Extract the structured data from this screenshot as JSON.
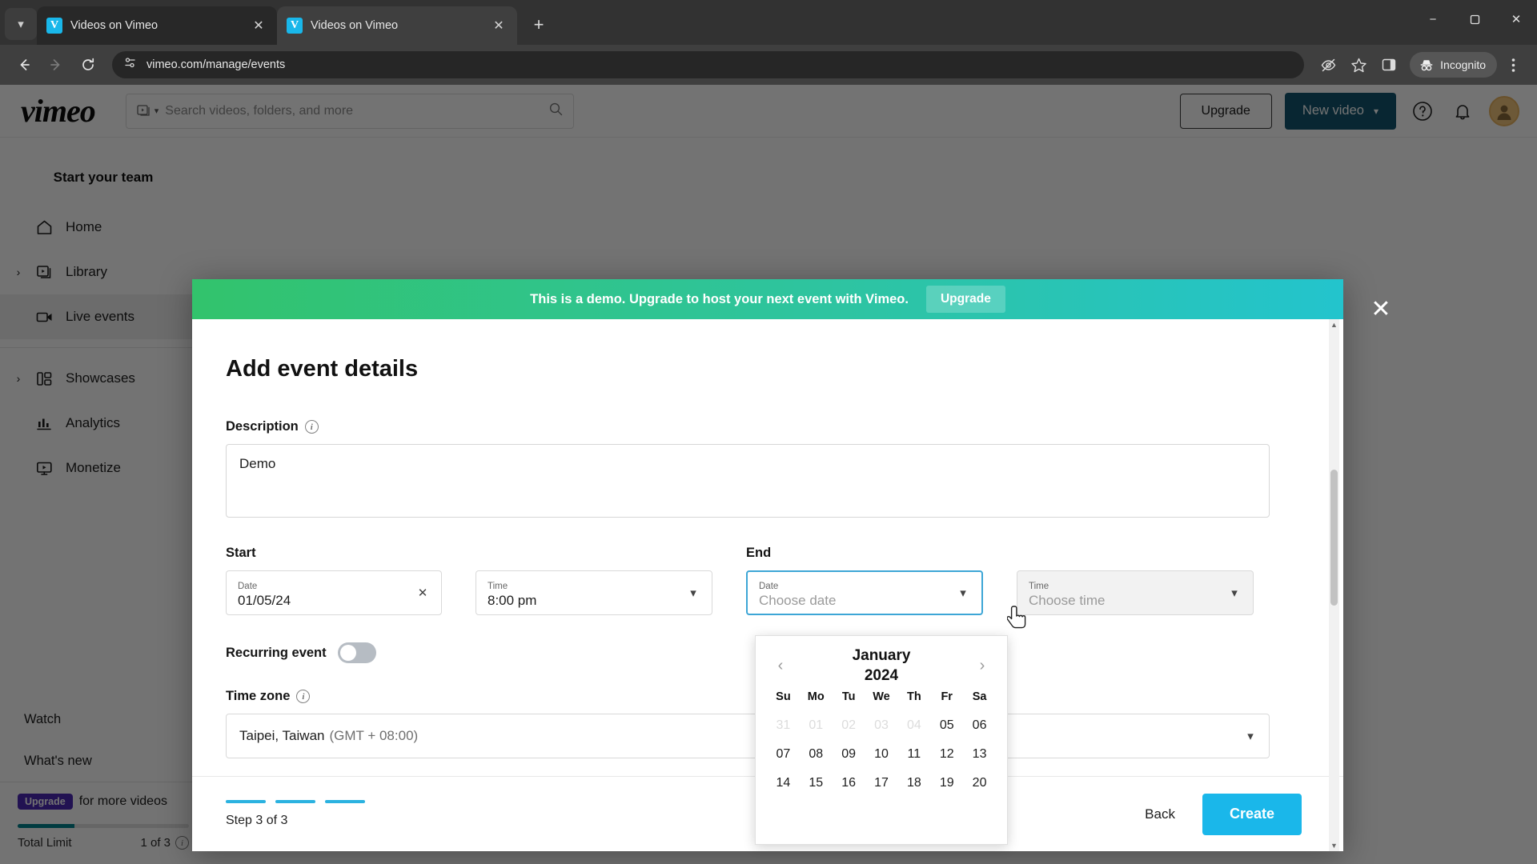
{
  "browser": {
    "tabs": [
      {
        "title": "Videos on Vimeo",
        "favicon": "vimeo-favicon",
        "active": false
      },
      {
        "title": "Videos on Vimeo",
        "favicon": "vimeo-favicon",
        "active": true
      }
    ],
    "new_tab_label": "+",
    "window_controls": {
      "minimize": "−",
      "maximize": "❐",
      "close": "✕"
    },
    "tab_list_icon": "chevron-down-icon",
    "nav": {
      "back": "←",
      "forward": "→",
      "reload": "↻"
    },
    "url": "vimeo.com/manage/events",
    "site_info_icon": "page-settings-icon",
    "toolbar_icons": [
      "eye-off-icon",
      "star-icon",
      "side-panel-icon"
    ],
    "incognito_label": "Incognito",
    "menu_icon": "three-dot-menu-icon"
  },
  "vimeo_header": {
    "logo": "vimeo",
    "search": {
      "placeholder": "Search videos, folders, and more",
      "value": "",
      "scope_icon": "video-library-icon",
      "search_icon": "search-icon"
    },
    "upgrade_label": "Upgrade",
    "new_video_label": "New video",
    "help_icon": "help-circle-icon",
    "notifications_icon": "bell-icon",
    "avatar": "user-avatar"
  },
  "sidebar": {
    "team_label": "Start your team",
    "items": [
      {
        "label": "Home",
        "icon": "home-icon",
        "expandable": false,
        "active": false
      },
      {
        "label": "Library",
        "icon": "library-icon",
        "expandable": true,
        "active": false
      },
      {
        "label": "Live events",
        "icon": "live-events-icon",
        "expandable": false,
        "active": true
      },
      {
        "label": "Showcases",
        "icon": "showcases-icon",
        "expandable": true,
        "active": false
      },
      {
        "label": "Analytics",
        "icon": "analytics-icon",
        "expandable": false,
        "active": false
      },
      {
        "label": "Monetize",
        "icon": "monetize-icon",
        "expandable": false,
        "active": false
      }
    ],
    "footer_links": [
      "Watch",
      "What's new"
    ],
    "upgrade_badge": "Upgrade",
    "upgrade_text": "for more videos",
    "limit_label": "Total Limit",
    "limit_value": "1 of 3",
    "limit_percent": 33,
    "limit_info_icon": "info-icon"
  },
  "modal": {
    "banner": {
      "text": "This is a demo. Upgrade to host your next event with Vimeo.",
      "button": "Upgrade",
      "gradient_from": "#32c36c",
      "gradient_to": "#23c4cd"
    },
    "close_icon": "close-icon",
    "title": "Add event details",
    "description": {
      "label": "Description",
      "info_icon": "info-icon",
      "value": "Demo"
    },
    "start": {
      "group_label": "Start",
      "date": {
        "mini_label": "Date",
        "value": "01/05/24",
        "affordance": "clear-x-icon"
      },
      "time": {
        "mini_label": "Time",
        "value": "8:00 pm",
        "affordance": "chevron-down-icon"
      }
    },
    "end": {
      "group_label": "End",
      "date": {
        "mini_label": "Date",
        "placeholder": "Choose date",
        "value": "",
        "affordance": "chevron-down-icon",
        "focused": true
      },
      "time": {
        "mini_label": "Time",
        "placeholder": "Choose time",
        "value": "",
        "affordance": "chevron-down-icon",
        "disabled": true
      }
    },
    "recurring": {
      "label": "Recurring event",
      "enabled": false
    },
    "timezone": {
      "label": "Time zone",
      "info_icon": "info-icon",
      "value": "Taipei, Taiwan",
      "offset": "(GMT + 08:00)",
      "affordance": "chevron-down-icon"
    },
    "footer": {
      "step_text": "Step 3 of 3",
      "steps_total": 3,
      "back_label": "Back",
      "create_label": "Create",
      "create_color": "#1ab7ea"
    }
  },
  "calendar": {
    "prev_icon": "chevron-left-icon",
    "next_icon": "chevron-right-icon",
    "month": "January",
    "year": "2024",
    "weekdays": [
      "Su",
      "Mo",
      "Tu",
      "We",
      "Th",
      "Fr",
      "Sa"
    ],
    "weeks": [
      [
        {
          "d": "31",
          "dim": true
        },
        {
          "d": "01",
          "dim": true
        },
        {
          "d": "02",
          "dim": true
        },
        {
          "d": "03",
          "dim": true
        },
        {
          "d": "04",
          "dim": true
        },
        {
          "d": "05",
          "dim": false
        },
        {
          "d": "06",
          "dim": false
        }
      ],
      [
        {
          "d": "07",
          "dim": false
        },
        {
          "d": "08",
          "dim": false
        },
        {
          "d": "09",
          "dim": false
        },
        {
          "d": "10",
          "dim": false
        },
        {
          "d": "11",
          "dim": false
        },
        {
          "d": "12",
          "dim": false
        },
        {
          "d": "13",
          "dim": false
        }
      ],
      [
        {
          "d": "14",
          "dim": false
        },
        {
          "d": "15",
          "dim": false
        },
        {
          "d": "16",
          "dim": false
        },
        {
          "d": "17",
          "dim": false
        },
        {
          "d": "18",
          "dim": false
        },
        {
          "d": "19",
          "dim": false
        },
        {
          "d": "20",
          "dim": false
        }
      ]
    ]
  }
}
